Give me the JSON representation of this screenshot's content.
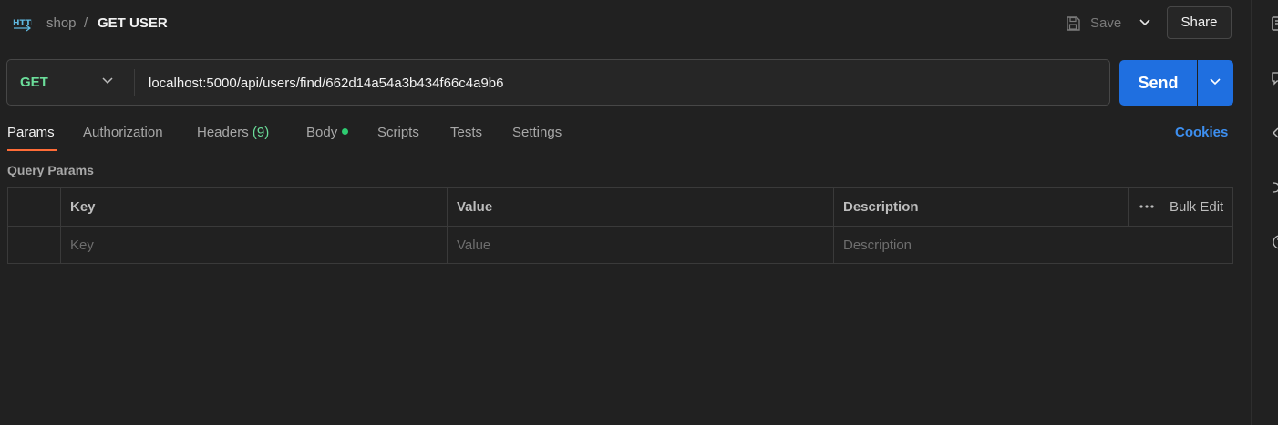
{
  "header": {
    "breadcrumb_parent": "shop",
    "breadcrumb_sep": "/",
    "title": "GET USER",
    "save_label": "Save",
    "share_label": "Share"
  },
  "request": {
    "method": "GET",
    "url": "localhost:5000/api/users/find/662d14a54a3b434f66c4a9b6",
    "send_label": "Send"
  },
  "tabs": [
    {
      "label": "Params"
    },
    {
      "label": "Authorization"
    },
    {
      "label": "Headers",
      "count": "(9)"
    },
    {
      "label": "Body"
    },
    {
      "label": "Scripts"
    },
    {
      "label": "Tests"
    },
    {
      "label": "Settings"
    }
  ],
  "cookies_label": "Cookies",
  "query_params": {
    "title": "Query Params",
    "columns": {
      "key": "Key",
      "value": "Value",
      "description": "Description"
    },
    "bulk_edit": "Bulk Edit",
    "placeholders": {
      "key": "Key",
      "value": "Value",
      "description": "Description"
    }
  },
  "colors": {
    "method_get": "#6bdd9a",
    "send_button": "#1f6fe0",
    "active_tab_underline": "#ff6c37",
    "cookies_link": "#3d8ff0"
  }
}
